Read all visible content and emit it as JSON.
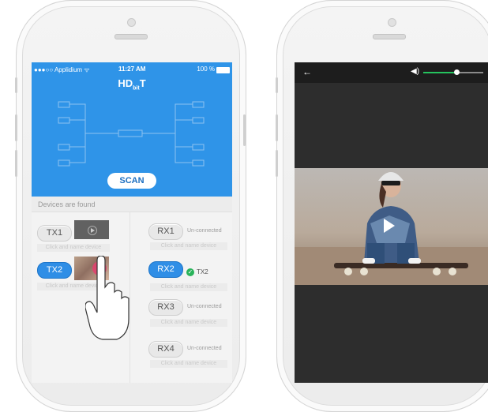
{
  "left_phone": {
    "status_bar": {
      "carrier": "●●●○○ Applidium ᯤ",
      "time": "11:27 AM",
      "battery": "100 %"
    },
    "logo": {
      "main": "HD",
      "sub": "bit",
      "tail": "T"
    },
    "scan_label": "SCAN",
    "devices_label": "Devices are found",
    "transmitters": [
      {
        "label": "TX1",
        "name_placeholder": "Click and name device",
        "selected": false
      },
      {
        "label": "TX2",
        "name_placeholder": "Click and name device",
        "selected": true
      }
    ],
    "receivers": [
      {
        "label": "RX1",
        "status": "Un-connected",
        "name_placeholder": "Click and name device",
        "selected": false
      },
      {
        "label": "RX2",
        "status": "TX2",
        "name_placeholder": "Click and name device",
        "selected": true
      },
      {
        "label": "RX3",
        "status": "Un-connected",
        "name_placeholder": "Click and name device",
        "selected": false
      },
      {
        "label": "RX4",
        "status": "Un-connected",
        "name_placeholder": "Click and name device",
        "selected": false
      }
    ],
    "colors": {
      "header_blue": "#2f94e8",
      "selected_blue": "#2f8ee6",
      "connected_green": "#29b35a"
    }
  },
  "right_phone": {
    "back_icon": "back-arrow-icon",
    "volume_icon": "speaker-icon",
    "volume_level": 0.55,
    "colors": {
      "volume_fill": "#25c35e"
    }
  }
}
